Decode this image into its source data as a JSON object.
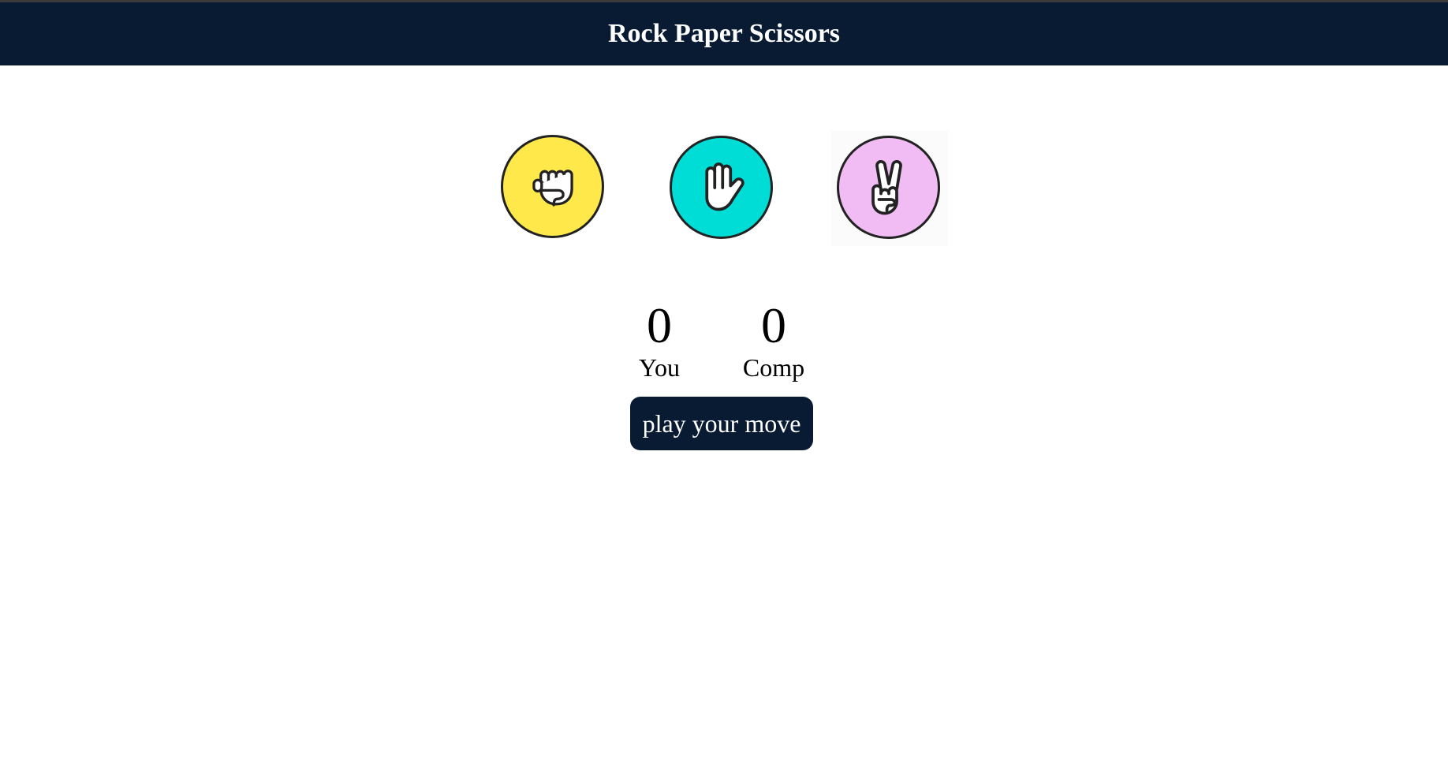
{
  "header": {
    "title": "Rock Paper Scissors"
  },
  "choices": [
    {
      "id": "rock",
      "icon": "fist-icon",
      "color": "#ffe84a"
    },
    {
      "id": "paper",
      "icon": "open-hand-icon",
      "color": "#00ddd6"
    },
    {
      "id": "scissors",
      "icon": "peace-hand-icon",
      "color": "#f1bcf4"
    }
  ],
  "score": {
    "user_score": "0",
    "user_label": "You",
    "comp_score": "0",
    "comp_label": "Comp"
  },
  "message": {
    "text": "play your move"
  },
  "colors": {
    "nav_bg": "#081b33",
    "message_bg": "#081b33"
  }
}
